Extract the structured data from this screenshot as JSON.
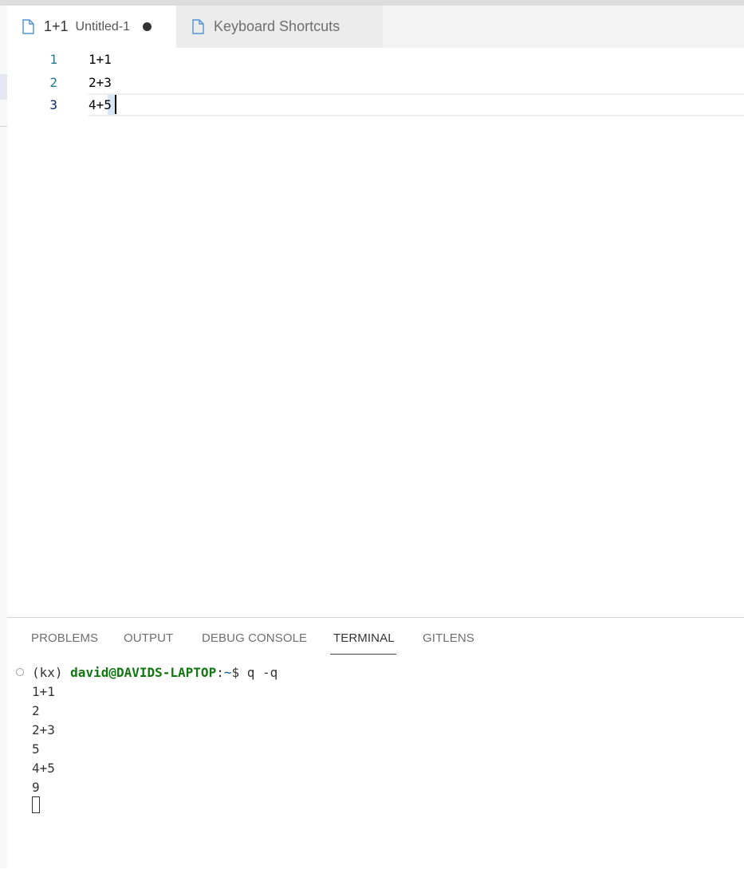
{
  "tabs": [
    {
      "title": "1+1",
      "description": "Untitled-1",
      "dirty": true
    },
    {
      "title": "Keyboard Shortcuts"
    }
  ],
  "editor": {
    "lines": [
      {
        "number": "1",
        "code": "1+1"
      },
      {
        "number": "2",
        "code": "2+3"
      },
      {
        "number": "3",
        "code": "4+5"
      }
    ]
  },
  "panel": {
    "tabs": [
      "PROBLEMS",
      "OUTPUT",
      "DEBUG CONSOLE",
      "TERMINAL",
      "GITLENS"
    ],
    "active_tab": "TERMINAL"
  },
  "terminal": {
    "prompt": {
      "env": "(kx) ",
      "user_host": "david@DAVIDS-LAPTOP",
      "colon": ":",
      "path": "~",
      "symbol": "$ ",
      "command": "q -q"
    },
    "output": [
      "1+1",
      "2",
      "2+3",
      "5",
      "4+5",
      "9"
    ]
  },
  "colors": {
    "file_icon": "#4f93d6",
    "prompt_user": "#117711",
    "prompt_path": "#0451a5",
    "line_number": "#237893"
  },
  "icons": {
    "tab_file": "file-icon",
    "dirty": "dot-icon",
    "terminal_status": "circle-icon"
  }
}
